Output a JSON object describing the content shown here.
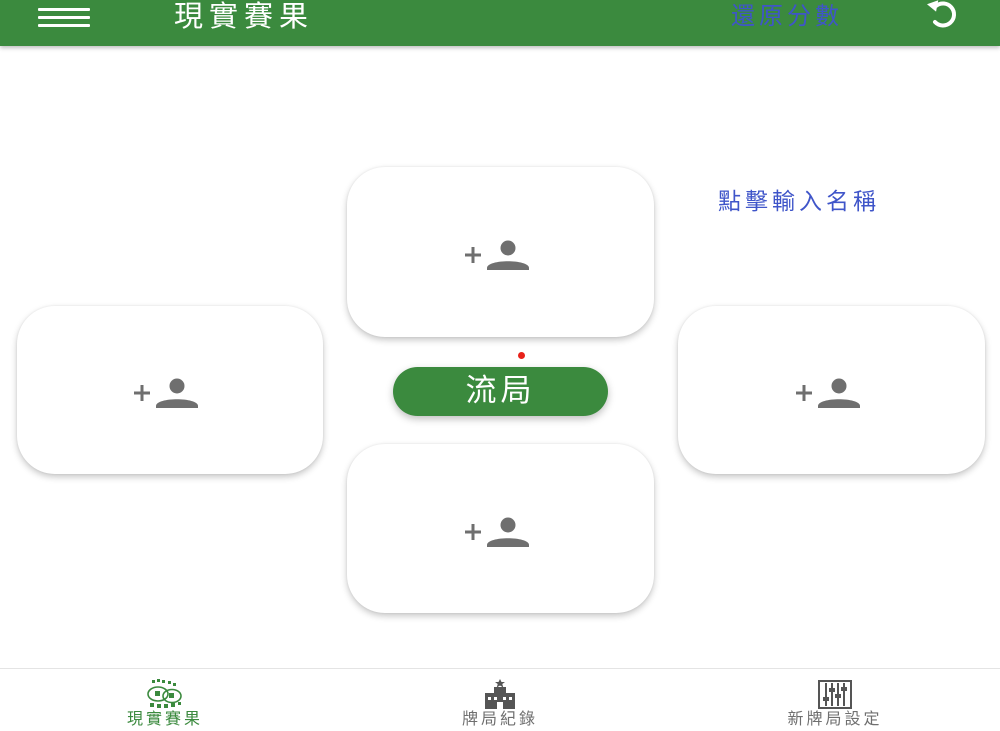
{
  "appbar": {
    "title": "現實賽果",
    "restore_label": "還原分數",
    "menu_icon": "menu-icon",
    "undo_icon": "undo-icon",
    "background_color": "#3b8a3e"
  },
  "name_hint": "點擊輸入名稱",
  "seats": [
    {
      "position": "top",
      "icon": "add-person-icon"
    },
    {
      "position": "left",
      "icon": "add-person-icon"
    },
    {
      "position": "right",
      "icon": "add-person-icon"
    },
    {
      "position": "bottom",
      "icon": "add-person-icon"
    }
  ],
  "center": {
    "draw_label": "流局",
    "dealer_dot_color": "#e8221a"
  },
  "bottom_nav": {
    "items": [
      {
        "label": "現實賽果",
        "icon": "mahjong-tiles-icon",
        "active": true
      },
      {
        "label": "牌局紀錄",
        "icon": "building-icon",
        "active": false
      },
      {
        "label": "新牌局設定",
        "icon": "sliders-icon",
        "active": false
      }
    ]
  },
  "colors": {
    "accent_green": "#3b8a3e",
    "link_blue": "#3f55c9",
    "icon_gray": "#6f6f6f"
  }
}
